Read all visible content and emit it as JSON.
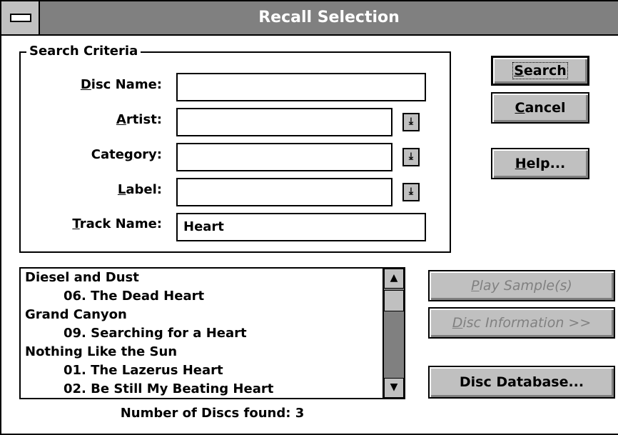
{
  "window": {
    "title": "Recall Selection"
  },
  "criteria": {
    "legend": "Search Criteria",
    "disc_name": {
      "prefix": "",
      "key": "D",
      "rest": "isc Name:",
      "value": ""
    },
    "artist": {
      "prefix": "",
      "key": "A",
      "rest": "rtist:",
      "value": ""
    },
    "category": {
      "prefix": "Cate",
      "key": "g",
      "rest": "ory:",
      "value": ""
    },
    "label": {
      "prefix": "",
      "key": "L",
      "rest": "abel:",
      "value": ""
    },
    "track_name": {
      "prefix": "",
      "key": "T",
      "rest": "rack Name:",
      "value": "Heart"
    }
  },
  "buttons": {
    "search": {
      "key": "S",
      "rest": "earch"
    },
    "cancel": {
      "key": "C",
      "rest": "ancel"
    },
    "help": {
      "key": "H",
      "rest": "elp..."
    },
    "play_sample": {
      "key": "P",
      "rest": "lay Sample(s)"
    },
    "disc_information": {
      "key": "D",
      "rest": "isc Information >>"
    },
    "disc_database": {
      "label": "Disc Database..."
    }
  },
  "results": [
    {
      "type": "disc",
      "text": "Diesel and Dust"
    },
    {
      "type": "track",
      "text": "06. The Dead Heart"
    },
    {
      "type": "disc",
      "text": "Grand Canyon"
    },
    {
      "type": "track",
      "text": "09. Searching for a Heart"
    },
    {
      "type": "disc",
      "text": "Nothing Like the Sun"
    },
    {
      "type": "track",
      "text": "01. The Lazerus Heart"
    },
    {
      "type": "track",
      "text": "02. Be Still My Beating Heart"
    }
  ],
  "status": {
    "label": "Number of Discs found:",
    "count": "3"
  },
  "icons": {
    "dropdown": "arrow-down-bar",
    "scroll_up": "arrow-up",
    "scroll_down": "arrow-down",
    "system_menu": "minus-bar"
  },
  "colors": {
    "titlebar": "#808080",
    "button_face": "#c0c0c0",
    "disabled_text": "#808080"
  }
}
